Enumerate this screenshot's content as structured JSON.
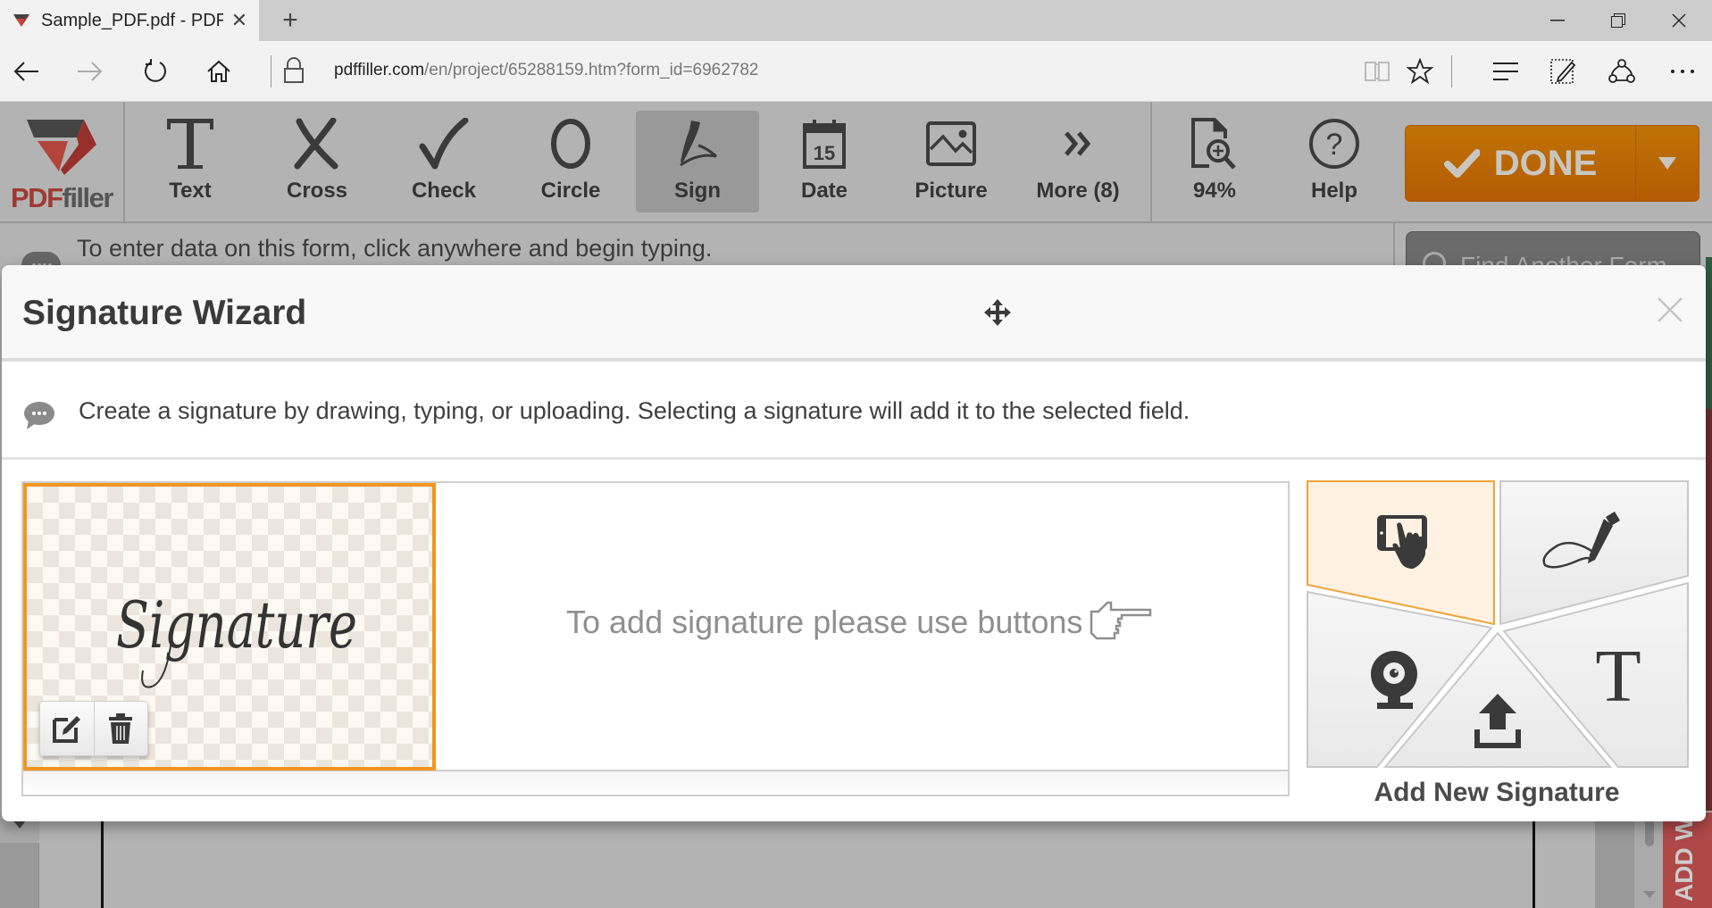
{
  "browser": {
    "tab_title": "Sample_PDF.pdf - PDFfi",
    "url_domain": "pdffiller.com",
    "url_path": "/en/project/65288159.htm?form_id=6962782",
    "icons": [
      "back-icon",
      "forward-icon",
      "refresh-icon",
      "home-icon",
      "lock-icon",
      "reading-view-icon",
      "favorite-star-icon",
      "hub-icon",
      "web-note-icon",
      "share-icon",
      "more-icon"
    ]
  },
  "toolbar": {
    "logo": {
      "pdf": "PDF",
      "filler": "filler"
    },
    "tools": [
      {
        "id": "text",
        "label": "Text",
        "icon": "text-T-icon",
        "active": false
      },
      {
        "id": "cross",
        "label": "Cross",
        "icon": "cross-x-icon",
        "active": false
      },
      {
        "id": "check",
        "label": "Check",
        "icon": "checkmark-icon",
        "active": false
      },
      {
        "id": "circle",
        "label": "Circle",
        "icon": "circle-icon",
        "active": false
      },
      {
        "id": "sign",
        "label": "Sign",
        "icon": "pen-sign-icon",
        "active": true
      },
      {
        "id": "date",
        "label": "Date",
        "icon": "calendar-icon",
        "active": false
      },
      {
        "id": "picture",
        "label": "Picture",
        "icon": "picture-icon",
        "active": false
      },
      {
        "id": "more",
        "label": "More (8)",
        "icon": "double-chevron-icon",
        "active": false
      }
    ],
    "zoom": {
      "label": "94%",
      "icon": "zoom-doc-icon"
    },
    "help": {
      "label": "Help",
      "icon": "help-circle-icon"
    },
    "done": {
      "label": "DONE",
      "accent": "#bb6a05"
    },
    "calendar_day": "15"
  },
  "page": {
    "info_text": "To enter data on this form, click anywhere and begin typing.",
    "find_form_placeholder": "Find Another Form",
    "side_tab_label": "ADD WI"
  },
  "modal": {
    "title": "Signature Wizard",
    "hint": "Create a signature by drawing, typing, or uploading. Selecting a signature will add it to the selected field.",
    "empty_message": "To add signature please use buttons",
    "signature_card": {
      "text": "Signature",
      "selected": true,
      "accent": "#f0961e"
    },
    "add_title": "Add New Signature",
    "add_options": [
      {
        "id": "draw-touch",
        "icon": "tablet-touch-icon",
        "selected": true
      },
      {
        "id": "draw-pen",
        "icon": "pen-signature-icon",
        "selected": false
      },
      {
        "id": "webcam",
        "icon": "webcam-icon",
        "selected": false
      },
      {
        "id": "upload",
        "icon": "upload-icon",
        "selected": false
      },
      {
        "id": "type",
        "icon": "type-T-icon",
        "selected": false
      }
    ]
  }
}
